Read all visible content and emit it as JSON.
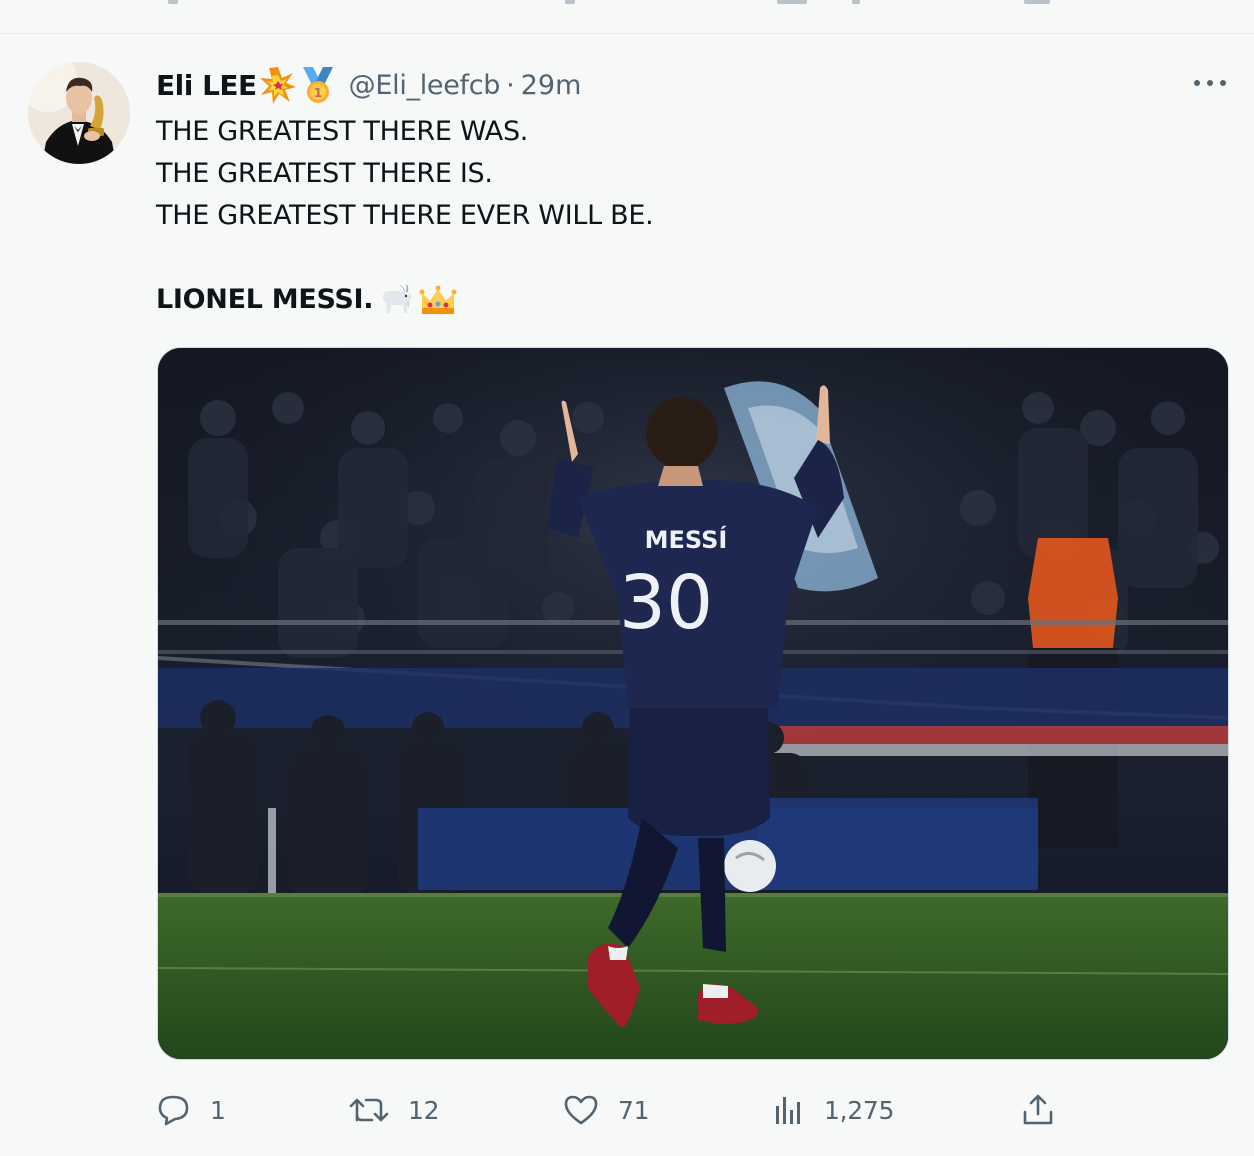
{
  "tweet": {
    "author": {
      "display_name": "Eli LEE",
      "name_emojis": [
        "collision-emoji",
        "first-place-medal-emoji"
      ],
      "handle": "@Eli_leefcb",
      "separator": "·",
      "timestamp": "29m"
    },
    "text_lines": [
      "THE GREATEST THERE WAS.",
      "THE GREATEST THERE IS.",
      "THE GREATEST THERE EVER WILL BE."
    ],
    "bold_line": "LIONEL MESSI.",
    "bold_line_emojis": [
      "goat-emoji",
      "crown-emoji"
    ],
    "media": {
      "jersey_name": "MESSÍ",
      "jersey_number": "30"
    },
    "actions": {
      "reply": {
        "icon": "reply-icon",
        "count": "1"
      },
      "retweet": {
        "icon": "retweet-icon",
        "count": "12"
      },
      "like": {
        "icon": "heart-icon",
        "count": "71"
      },
      "views": {
        "icon": "views-chart-icon",
        "count": "1,275"
      },
      "share": {
        "icon": "share-icon"
      }
    }
  },
  "colors": {
    "background": "#f7f9f9",
    "text_primary": "#0f1419",
    "text_secondary": "#536471",
    "border": "#cfd9de"
  }
}
